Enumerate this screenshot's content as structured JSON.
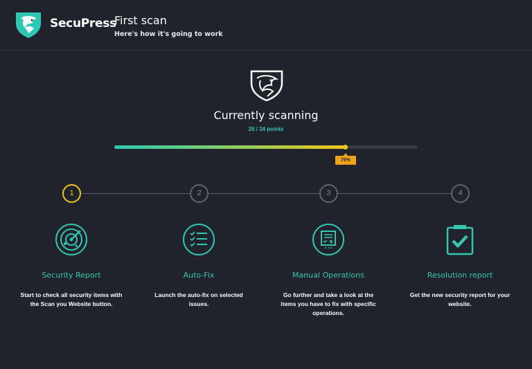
{
  "header": {
    "brand": "SecuPress",
    "title": "First scan",
    "subtitle": "Here's how it's going to work",
    "logo_icon": "eagle-shield-icon"
  },
  "scan": {
    "title": "Currently scanning",
    "points_text": "26 / 34 points",
    "progress_percent": 76,
    "progress_label": "76%",
    "icon": "eagle-shield-outline-icon"
  },
  "colors": {
    "background": "#20232c",
    "accent_teal": "#34c6b0",
    "accent_yellow": "#f0c419",
    "badge_orange": "#f0a21a"
  },
  "steps": [
    {
      "number": "1",
      "label": "Security Report",
      "description": "Start to check all security items with the Scan you Website button.",
      "icon": "radar-icon",
      "active": true
    },
    {
      "number": "2",
      "label": "Auto-Fix",
      "description": "Launch the auto-fix on selected issues.",
      "icon": "checklist-icon",
      "active": false
    },
    {
      "number": "3",
      "label": "Manual Operations",
      "description": "Go further and take a look at the items you have to fix with specific operations.",
      "icon": "manual-fix-icon",
      "active": false
    },
    {
      "number": "4",
      "label": "Resolution report",
      "description": "Get the new security report for your website.",
      "icon": "clipboard-check-icon",
      "active": false
    }
  ]
}
